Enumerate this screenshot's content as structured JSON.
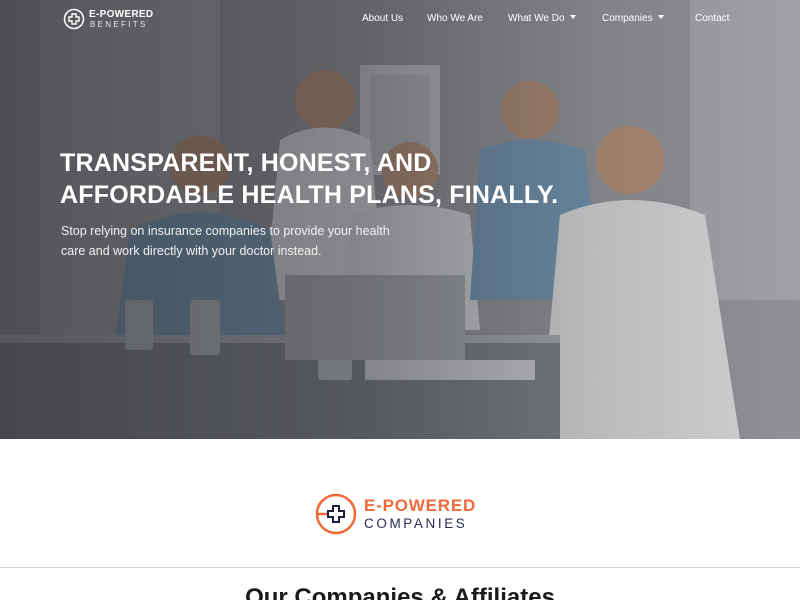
{
  "header": {
    "logo": {
      "line1": "E-POWERED",
      "line2": "BENEFITS"
    },
    "nav": [
      {
        "label": "About Us",
        "has_dropdown": false
      },
      {
        "label": "Who We Are",
        "has_dropdown": false
      },
      {
        "label": "What We Do",
        "has_dropdown": true
      },
      {
        "label": "Companies",
        "has_dropdown": true
      },
      {
        "label": "Contact",
        "has_dropdown": false
      }
    ]
  },
  "hero": {
    "title_line1": "TRANSPARENT, HONEST, AND",
    "title_line2": "AFFORDABLE HEALTH PLANS, FINALLY.",
    "subtitle": "Stop relying on insurance companies to provide your health care and work directly with your doctor instead."
  },
  "companies": {
    "logo": {
      "line1": "E-POWERED",
      "line2": "COMPANIES"
    },
    "section_title": "Our Companies & Affiliates"
  },
  "colors": {
    "accent": "#ef6a3a",
    "brand_navy": "#2b2b5a",
    "text_dark": "#1a1a1a"
  },
  "icons": {
    "logo_mark": "medical-cross-circle-icon",
    "dropdown": "caret-down-icon"
  }
}
